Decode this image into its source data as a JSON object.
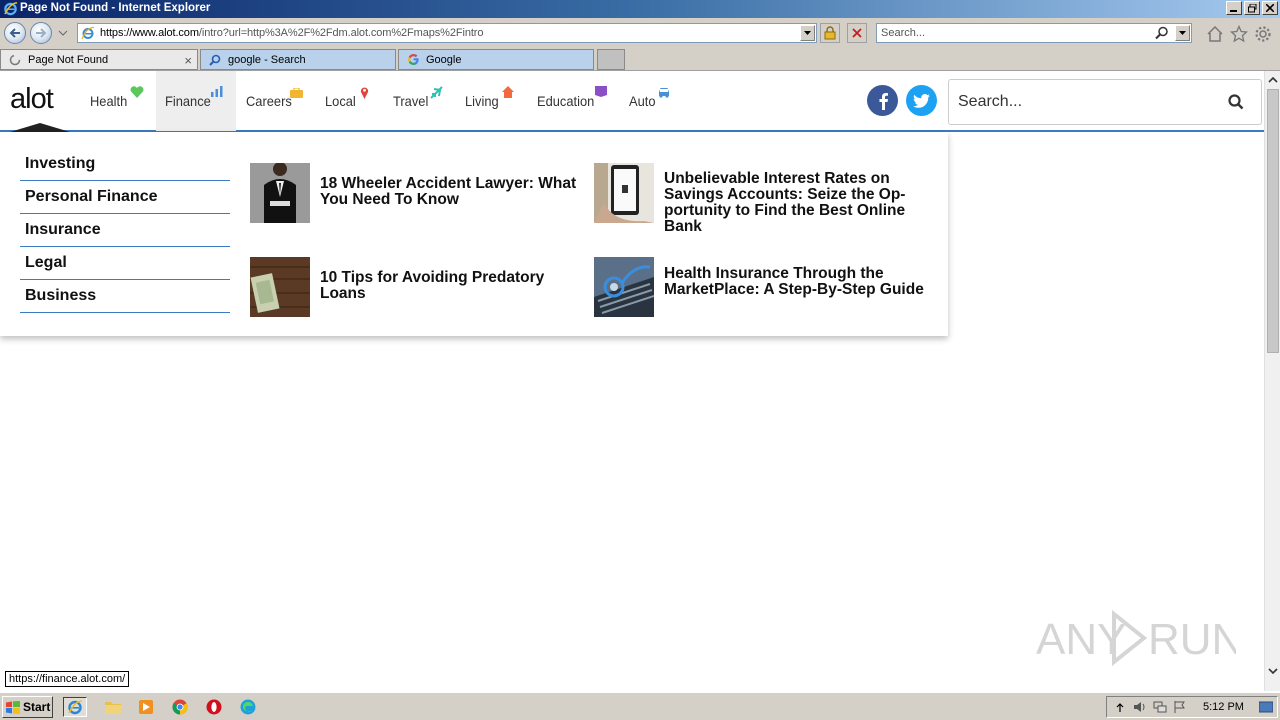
{
  "window": {
    "title": "Page Not Found - Internet Explorer"
  },
  "address_bar": {
    "url_prefix": "https://www.",
    "url_host": "alot.com",
    "url_rest": "/intro?url=http%3A%2F%2Fdm.alot.com%2Fmaps%2Fintro",
    "search_placeholder": "Search..."
  },
  "tabs": [
    {
      "label": "Page Not Found",
      "icon": "loading-icon",
      "active": true
    },
    {
      "label": "google - Search",
      "icon": "search-icon",
      "active": false
    },
    {
      "label": "Google",
      "icon": "google-icon",
      "active": false
    }
  ],
  "site": {
    "logo": "alot",
    "nav": [
      {
        "label": "Health",
        "icon": "heart-icon",
        "color": "#5cc85c"
      },
      {
        "label": "Finance",
        "icon": "bar-chart-icon",
        "color": "#4a90d9"
      },
      {
        "label": "Careers",
        "icon": "briefcase-icon",
        "color": "#f2b531"
      },
      {
        "label": "Local",
        "icon": "map-pin-icon",
        "color": "#e0453b"
      },
      {
        "label": "Travel",
        "icon": "plane-icon",
        "color": "#2bc4b4"
      },
      {
        "label": "Living",
        "icon": "house-icon",
        "color": "#f26a3c"
      },
      {
        "label": "Education",
        "icon": "book-icon",
        "color": "#8a4fc4"
      },
      {
        "label": "Auto",
        "icon": "car-icon",
        "color": "#4a90d9"
      }
    ],
    "search_placeholder": "Search...",
    "colors": {
      "facebook": "#3b5998",
      "twitter": "#1da1f2",
      "accent": "#3c7bbf"
    }
  },
  "dropdown": {
    "subnav": [
      "Investing",
      "Personal Finance",
      "Insurance",
      "Legal",
      "Business"
    ],
    "articles": [
      {
        "title": "18 Wheeler Accident Lawyer: What You Need To Know"
      },
      {
        "title": "10 Tips for Avoiding Predatory Loans"
      },
      {
        "title": "Unbelievable Interest Rates on Savings Accounts: Seize the Op-portunity to Find the Best Online Bank"
      },
      {
        "title": "Health Insurance Through the MarketPlace: A Step-By-Step Guide"
      }
    ]
  },
  "status_bar": {
    "link_preview": "https://finance.alot.com/"
  },
  "taskbar": {
    "start_label": "Start",
    "clock": "5:12 PM"
  }
}
